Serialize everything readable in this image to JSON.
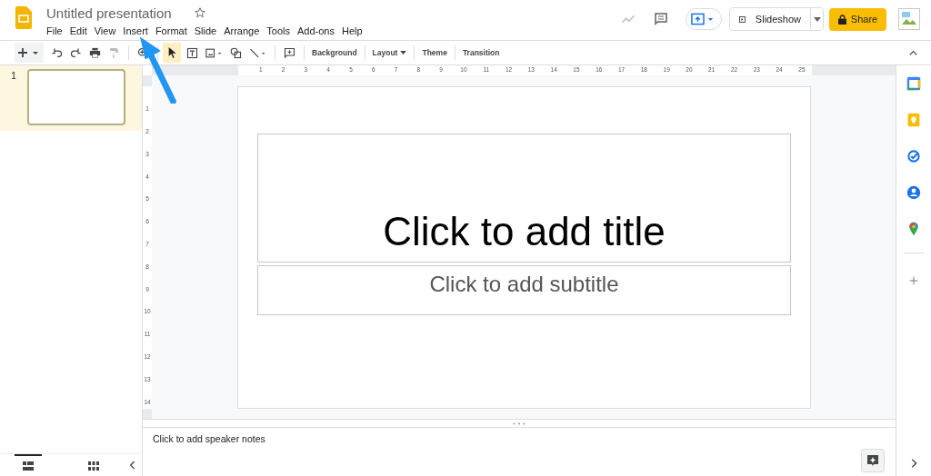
{
  "document": {
    "title": "Untitled presentation",
    "starred": false
  },
  "menu": [
    "File",
    "Edit",
    "View",
    "Insert",
    "Format",
    "Slide",
    "Arrange",
    "Tools",
    "Add-ons",
    "Help"
  ],
  "header_buttons": {
    "slideshow": "Slideshow",
    "share": "Share"
  },
  "toolbar": [
    {
      "label": "Background",
      "has_caret": false
    },
    {
      "label": "Layout",
      "has_caret": true
    },
    {
      "label": "Theme",
      "has_caret": false
    },
    {
      "label": "Transition",
      "has_caret": false
    }
  ],
  "select_tool": {
    "selected": true
  },
  "slides": [
    {
      "number": "1",
      "selected": true
    }
  ],
  "ruler": {
    "horizontal": [
      "1",
      "2",
      "3",
      "4",
      "5",
      "6",
      "7",
      "8",
      "9",
      "10",
      "11",
      "12",
      "13",
      "14",
      "15",
      "16",
      "17",
      "18",
      "19",
      "20",
      "21",
      "22",
      "23",
      "24",
      "25"
    ],
    "vertical": [
      "1",
      "2",
      "3",
      "4",
      "5",
      "6",
      "7",
      "8",
      "9",
      "10",
      "11",
      "12",
      "13",
      "14"
    ]
  },
  "slide": {
    "title_placeholder": "Click to add title",
    "subtitle_placeholder": "Click to add subtitle"
  },
  "notes": {
    "placeholder": "Click to add speaker notes"
  },
  "views": [
    {
      "kind": "filmstrip",
      "selected": true
    },
    {
      "kind": "grid",
      "selected": false
    }
  ]
}
